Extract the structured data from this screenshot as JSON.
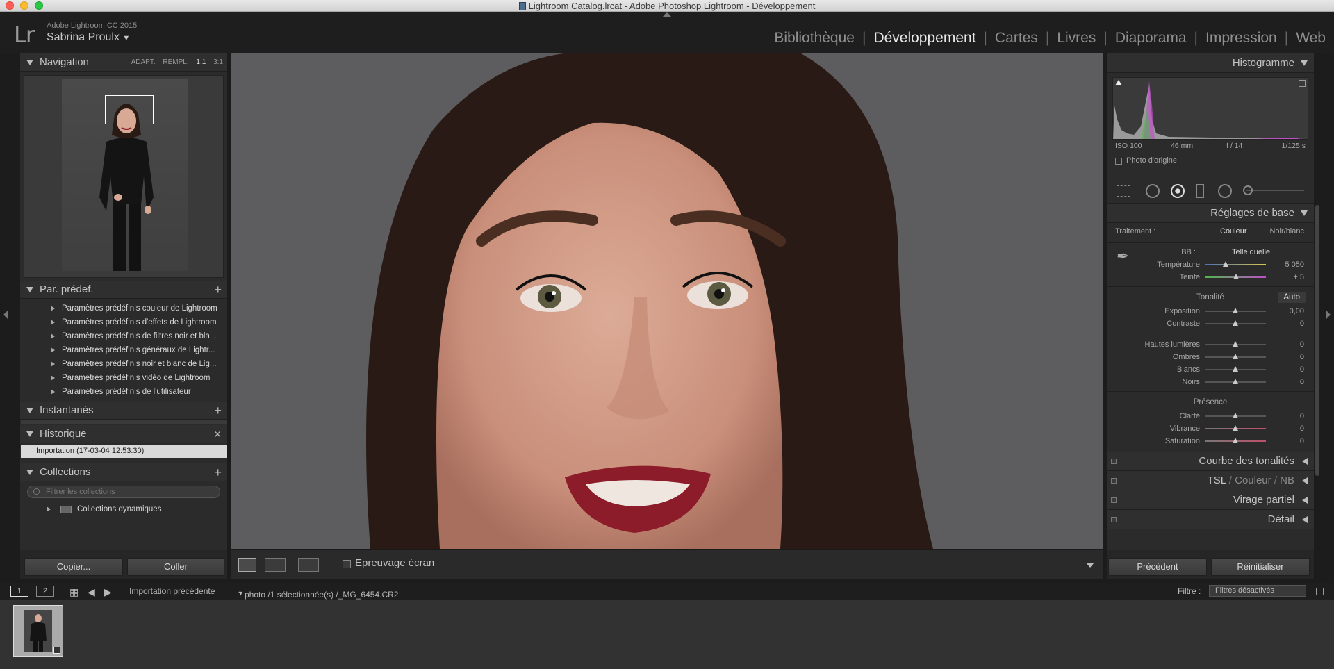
{
  "window": {
    "title": "Lightroom Catalog.lrcat - Adobe Photoshop Lightroom - Développement"
  },
  "header": {
    "logo": "Lr",
    "app_name": "Adobe Lightroom CC 2015",
    "user": "Sabrina Proulx",
    "modules": [
      "Bibliothèque",
      "Développement",
      "Cartes",
      "Livres",
      "Diaporama",
      "Impression",
      "Web"
    ],
    "active_module": "Développement"
  },
  "left": {
    "navigation": {
      "title": "Navigation",
      "zoom": [
        "ADAPT.",
        "REMPL.",
        "1:1",
        "3:1"
      ]
    },
    "presets": {
      "title": "Par. prédef.",
      "items": [
        "Paramètres prédéfinis couleur de Lightroom",
        "Paramètres prédéfinis d'effets de Lightroom",
        "Paramètres prédéfinis de filtres noir et bla...",
        "Paramètres prédéfinis généraux de Lightr...",
        "Paramètres prédéfinis noir et blanc de Lig...",
        "Paramètres prédéfinis vidéo de Lightroom",
        "Paramètres prédéfinis de l'utilisateur"
      ]
    },
    "snapshots": {
      "title": "Instantanés"
    },
    "history": {
      "title": "Historique",
      "items": [
        "Importation (17-03-04 12:53:30)"
      ]
    },
    "collections": {
      "title": "Collections",
      "filter_placeholder": "Filtrer les collections",
      "items": [
        "Collections dynamiques"
      ]
    },
    "buttons": {
      "copy": "Copier...",
      "paste": "Coller"
    }
  },
  "toolbar": {
    "soft_proof": "Epreuvage écran"
  },
  "right": {
    "histogram": {
      "title": "Histogramme",
      "iso": "ISO 100",
      "focal": "46 mm",
      "aperture": "f / 14",
      "shutter": "1/125 s",
      "original": "Photo d'origine"
    },
    "basic": {
      "title": "Réglages de base",
      "treatment_label": "Traitement :",
      "treatment_color": "Couleur",
      "treatment_bw": "Noir/blanc",
      "wb_label": "BB :",
      "wb_value": "Telle quelle",
      "temp": {
        "label": "Température",
        "value": "5 050"
      },
      "tint": {
        "label": "Teinte",
        "value": "+ 5"
      },
      "tone_label": "Tonalité",
      "auto": "Auto",
      "exposure": {
        "label": "Exposition",
        "value": "0,00"
      },
      "contrast": {
        "label": "Contraste",
        "value": "0"
      },
      "highlights": {
        "label": "Hautes lumières",
        "value": "0"
      },
      "shadows": {
        "label": "Ombres",
        "value": "0"
      },
      "whites": {
        "label": "Blancs",
        "value": "0"
      },
      "blacks": {
        "label": "Noirs",
        "value": "0"
      },
      "presence_label": "Présence",
      "clarity": {
        "label": "Clarté",
        "value": "0"
      },
      "vibrance": {
        "label": "Vibrance",
        "value": "0"
      },
      "saturation": {
        "label": "Saturation",
        "value": "0"
      }
    },
    "panels": {
      "curve": "Courbe des tonalités",
      "tsl": "TSL",
      "couleur": "Couleur",
      "nb": "NB",
      "split": "Virage partiel",
      "detail": "Détail"
    },
    "buttons": {
      "previous": "Précédent",
      "reset": "Réinitialiser"
    }
  },
  "filmbar": {
    "screen1": "1",
    "screen2": "2",
    "source": "Importation précédente",
    "info": "1 photo /1 sélectionnée(s) /_MG_6454.CR2",
    "filter_label": "Filtre :",
    "filter_value": "Filtres désactivés"
  },
  "colors": {
    "accent": "#d6d6d6",
    "lips": "#8c1c2a"
  }
}
